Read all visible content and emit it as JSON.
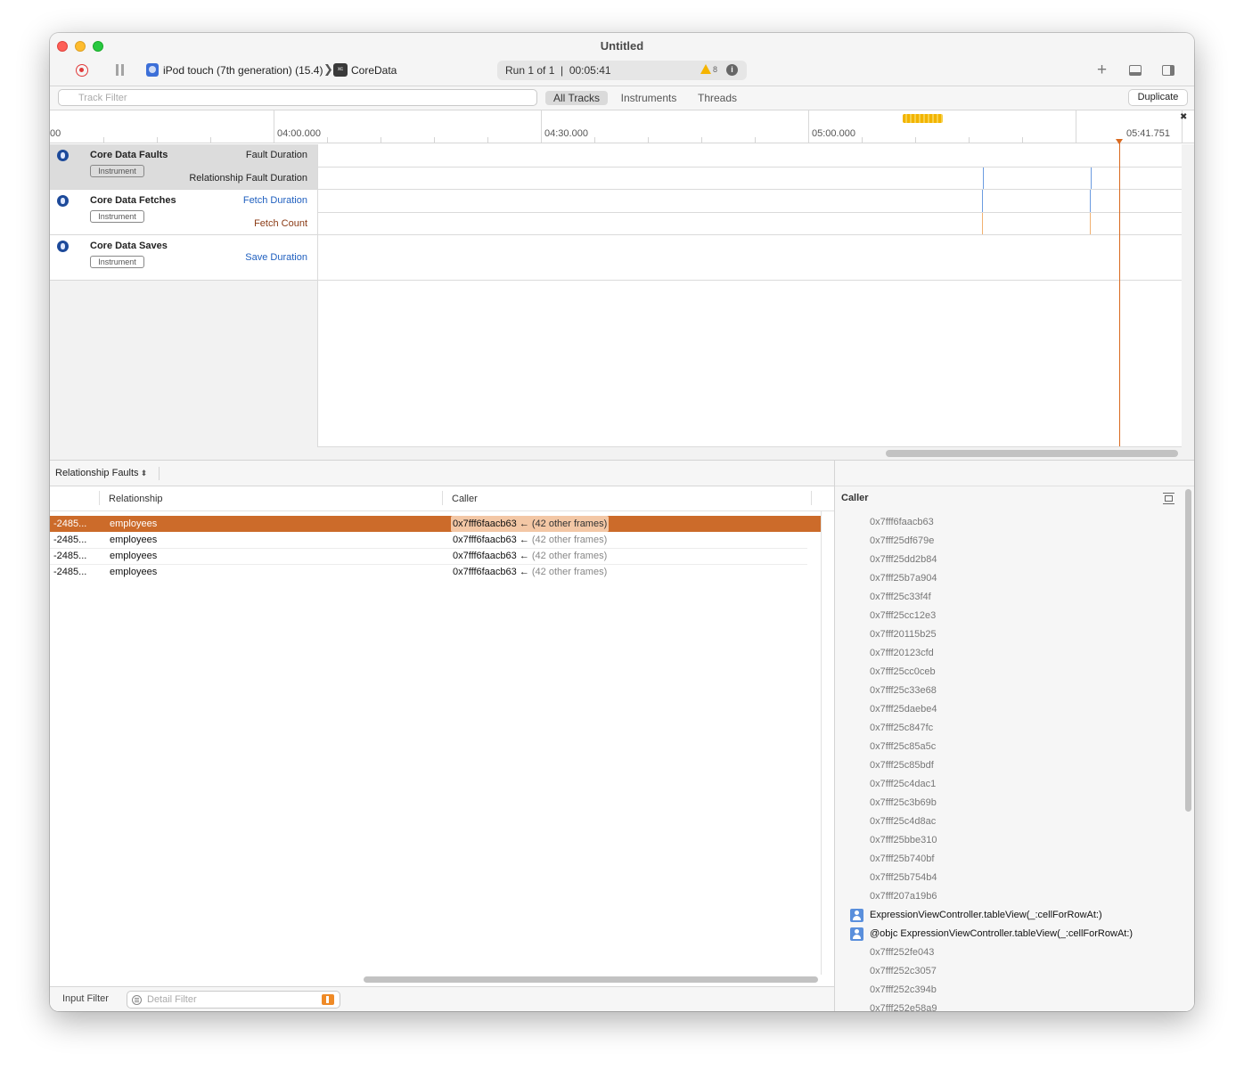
{
  "window": {
    "title": "Untitled"
  },
  "toolbar": {
    "device": "iPod touch (7th generation) (15.4)",
    "app": "CoreData",
    "app_icon_text": "xc",
    "run_info": "Run 1 of 1  |  00:05:41",
    "warnings": "8"
  },
  "filterbar": {
    "track_filter_placeholder": "Track Filter",
    "tabs": [
      "All Tracks",
      "Instruments",
      "Threads"
    ],
    "duplicate": "Duplicate"
  },
  "ruler": {
    "labels": [
      "00",
      "04:00.000",
      "04:30.000",
      "05:00.000",
      "05:41.751"
    ]
  },
  "tracks": [
    {
      "name": "Core Data Faults",
      "badge": "Instrument",
      "sub": [
        "Fault Duration",
        "Relationship Fault Duration"
      ]
    },
    {
      "name": "Core Data Fetches",
      "badge": "Instrument",
      "sub": [
        "Fetch Duration",
        "Fetch Count"
      ]
    },
    {
      "name": "Core Data Saves",
      "badge": "Instrument",
      "sub": [
        "Save Duration"
      ]
    }
  ],
  "colors": {
    "accent": "#cc6b2a",
    "playhead": "#d96a20",
    "fetch_duration": "#1f5fbf",
    "fetch_count": "#8a3a14",
    "mark_blue": "#6b9be0",
    "mark_orange": "#f0b070"
  },
  "detail": {
    "selector": "Relationship Faults",
    "columns": [
      "Relationship",
      "Caller"
    ],
    "rows": [
      {
        "id": "-2485...",
        "relationship": "employees",
        "caller": "0x7fff6faacb63 ←",
        "frames": "(42 other frames)"
      },
      {
        "id": "-2485...",
        "relationship": "employees",
        "caller": "0x7fff6faacb63 ←",
        "frames": "(42 other frames)"
      },
      {
        "id": "-2485...",
        "relationship": "employees",
        "caller": "0x7fff6faacb63 ←",
        "frames": "(42 other frames)"
      },
      {
        "id": "-2485...",
        "relationship": "employees",
        "caller": "0x7fff6faacb63 ←",
        "frames": "(42 other frames)"
      }
    ],
    "input_filter": "Input Filter",
    "detail_filter_placeholder": "Detail Filter"
  },
  "stack": {
    "header": "Caller",
    "frames": [
      "0x7fff6faacb63",
      "0x7fff25df679e",
      "0x7fff25dd2b84",
      "0x7fff25b7a904",
      "0x7fff25c33f4f",
      "0x7fff25cc12e3",
      "0x7fff20115b25",
      "0x7fff20123cfd",
      "0x7fff25cc0ceb",
      "0x7fff25c33e68",
      "0x7fff25daebe4",
      "0x7fff25c847fc",
      "0x7fff25c85a5c",
      "0x7fff25c85bdf",
      "0x7fff25c4dac1",
      "0x7fff25c3b69b",
      "0x7fff25c4d8ac",
      "0x7fff25bbe310",
      "0x7fff25b740bf",
      "0x7fff25b754b4",
      "0x7fff207a19b6",
      "ExpressionViewController.tableView(_:cellForRowAt:)",
      "@objc ExpressionViewController.tableView(_:cellForRowAt:)",
      "0x7fff252fe043",
      "0x7fff252c3057",
      "0x7fff252c394b",
      "0x7fff252e58a9"
    ]
  }
}
